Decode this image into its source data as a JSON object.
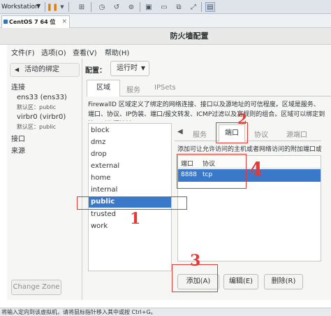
{
  "vmware": {
    "menu_label": "Workstation",
    "tab_label": "CentOS 7 64 位",
    "tab_close": "×",
    "status_text": "将输入定向到该虚拟机，请将鼠标指针移入其中或按 Ctrl+G。"
  },
  "window": {
    "title": "防火墙配置"
  },
  "menubar": {
    "items": [
      "文件(F)",
      "选项(O)",
      "查看(V)",
      "帮助(H)"
    ]
  },
  "left_panel": {
    "active_binding_label": "活动的绑定",
    "connection_heading": "连接",
    "connections": [
      {
        "name": "ens33 (ens33)",
        "zone": "默认区：public"
      },
      {
        "name": "virbr0 (virbr0)",
        "zone": "默认区：public"
      }
    ],
    "interfaces_heading": "接口",
    "sources_heading": "来源",
    "change_zone_button": "Change Zone"
  },
  "config": {
    "label": "配置：",
    "selected": "运行时"
  },
  "top_tabs": [
    "区域",
    "服务",
    "IPSets"
  ],
  "zone_description": "FirewallD 区域定义了绑定的网络连接、接口以及源地址的可信程度。区域是服务、端口、协议、IP伪装、端口/报文转发、ICMP过滤以及富规则的组合。区域可以绑定到接口以及源地址。",
  "zones": [
    "block",
    "dmz",
    "drop",
    "external",
    "home",
    "internal",
    "public",
    "trusted",
    "work"
  ],
  "selected_zone": "public",
  "sub_tabs": [
    "服务",
    "端口",
    "协议",
    "源端口"
  ],
  "sub_tab_back": "◀",
  "ports_description": "添加可让允许访问的主机或者网络访问的附加端口或者端口范围。",
  "ports_table": {
    "columns": [
      "端口",
      "协议"
    ],
    "rows": [
      {
        "port": "8888",
        "protocol": "tcp"
      }
    ]
  },
  "buttons": {
    "add": "添加(A)",
    "edit": "编辑(E)",
    "delete": "删除(R)"
  },
  "annotations": [
    "1",
    "2",
    "3",
    "4"
  ],
  "colors": {
    "selection": "#3a79c9",
    "annotation": "#e53935"
  }
}
